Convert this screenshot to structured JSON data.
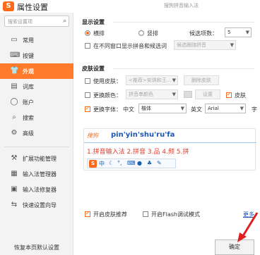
{
  "window": {
    "title": "属性设置",
    "subtitle": "搜狗拼音输入法"
  },
  "sidebar": {
    "search_placeholder": "搜索设置项",
    "items": [
      {
        "label": "常用",
        "icon": "monitor-icon"
      },
      {
        "label": "按键",
        "icon": "keyboard-icon"
      },
      {
        "label": "外观",
        "icon": "shirt-icon",
        "active": true
      },
      {
        "label": "词库",
        "icon": "book-icon"
      },
      {
        "label": "账户",
        "icon": "user-icon"
      },
      {
        "label": "搜索",
        "icon": "search-icon"
      },
      {
        "label": "高级",
        "icon": "gear-icon"
      }
    ],
    "extra_items": [
      {
        "label": "扩展功能管理",
        "icon": "extension-icon"
      },
      {
        "label": "输入法管理器",
        "icon": "manager-icon"
      },
      {
        "label": "输入法修复器",
        "icon": "repair-icon"
      },
      {
        "label": "快速设置向导",
        "icon": "wizard-icon"
      }
    ],
    "restore_label": "恢复本页默认设置"
  },
  "display": {
    "section_label": "显示设置",
    "horizontal_label": "横排",
    "vertical_label": "竖排",
    "horizontal_selected": true,
    "candidate_count_label": "候选项数：",
    "candidate_count_value": "5",
    "inline_label": "在不同窗口显示拼音和候选词",
    "inline_select_value": "候选跟随拼音"
  },
  "skin": {
    "section_label": "皮肤设置",
    "use_skin_label": "使用皮肤：",
    "use_skin_value": "<推荐>安琪和王…",
    "delete_skin_label": "删除皮肤",
    "change_color_label": "更换颜色：",
    "change_color_value": "拼音串颜色",
    "color_settings_label": "设置",
    "skin_partial_label": "皮肤",
    "change_font_label": "更换字体：",
    "chinese_label": "中文",
    "chinese_font_value": "楷体",
    "english_label": "英文",
    "english_font_value": "Arial",
    "size_partial_label": "字"
  },
  "preview": {
    "logo_text": "搜狗",
    "pinyin": "pin'yin'shu'ru'fa",
    "candidates": "1.拼音输入法  2.拼音  3.品  4.频  5.拼",
    "toolbar_logo": "S",
    "toolbar_chinese": "中"
  },
  "footer": {
    "recommend_label": "开启皮肤推荐",
    "recommend_checked": true,
    "flash_label": "开启Flash调试模式",
    "flash_checked": false,
    "link_label": "更多",
    "ok_label": "确定"
  },
  "colors": {
    "accent": "#ff7a2b",
    "link": "#1a56b4",
    "candidate": "#e03c2c",
    "annotation": "#e02020"
  }
}
